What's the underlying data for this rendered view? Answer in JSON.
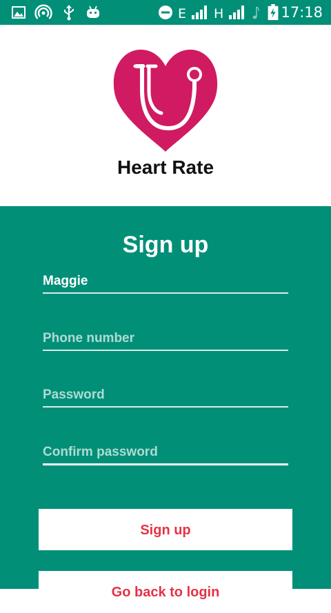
{
  "status_bar": {
    "time": "17:18",
    "network_1": "E",
    "network_2": "H",
    "icons": [
      "image-icon",
      "hotspot-icon",
      "usb-icon",
      "android-icon",
      "do-not-disturb-icon",
      "signal-icon",
      "signal-icon",
      "music-note-icon",
      "battery-charging-icon"
    ]
  },
  "header": {
    "app_name": "Heart Rate",
    "logo": "heart-stethoscope-logo"
  },
  "form": {
    "title": "Sign up",
    "name_value": "Maggie",
    "phone_placeholder": "Phone number",
    "password_placeholder": "Password",
    "confirm_placeholder": "Confirm password",
    "signup_button": "Sign up",
    "login_button": "Go back to login"
  },
  "colors": {
    "primary": "#028f78",
    "heart": "#d01b62",
    "button_text": "#e53245"
  }
}
